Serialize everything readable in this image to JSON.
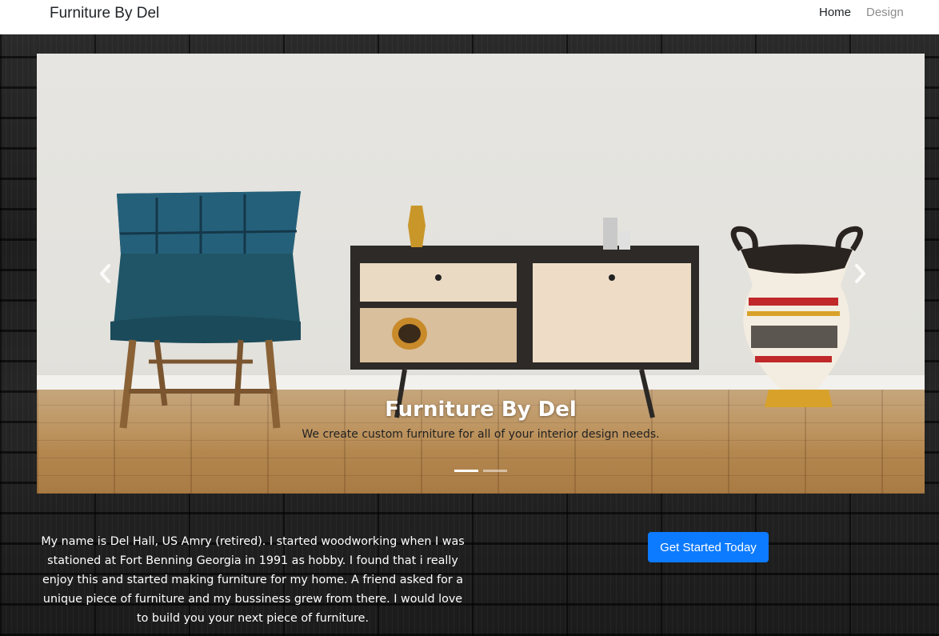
{
  "navbar": {
    "brand": "Furniture By Del",
    "links": {
      "home": "Home",
      "design": "Design"
    }
  },
  "carousel": {
    "caption_title": "Furniture By Del",
    "caption_text": "We create custom furniture for all of your interior design needs.",
    "slide_count": 2,
    "active_slide": 1,
    "prev_icon": "chevron-left-icon",
    "next_icon": "chevron-right-icon"
  },
  "about": {
    "text": "My name is Del Hall, US Amry (retired). I started woodworking when I was stationed at Fort Benning Georgia in 1991 as hobby. I found that i really enjoy this and started making furniture for my home. A friend asked for a unique piece of furniture and my bussiness grew from there. I would love to build you your next piece of furniture."
  },
  "cta": {
    "label": "Get Started Today"
  },
  "colors": {
    "accent": "#0d7bff",
    "navbar_bg": "#ffffff",
    "page_bg": "#1e1e1e"
  }
}
